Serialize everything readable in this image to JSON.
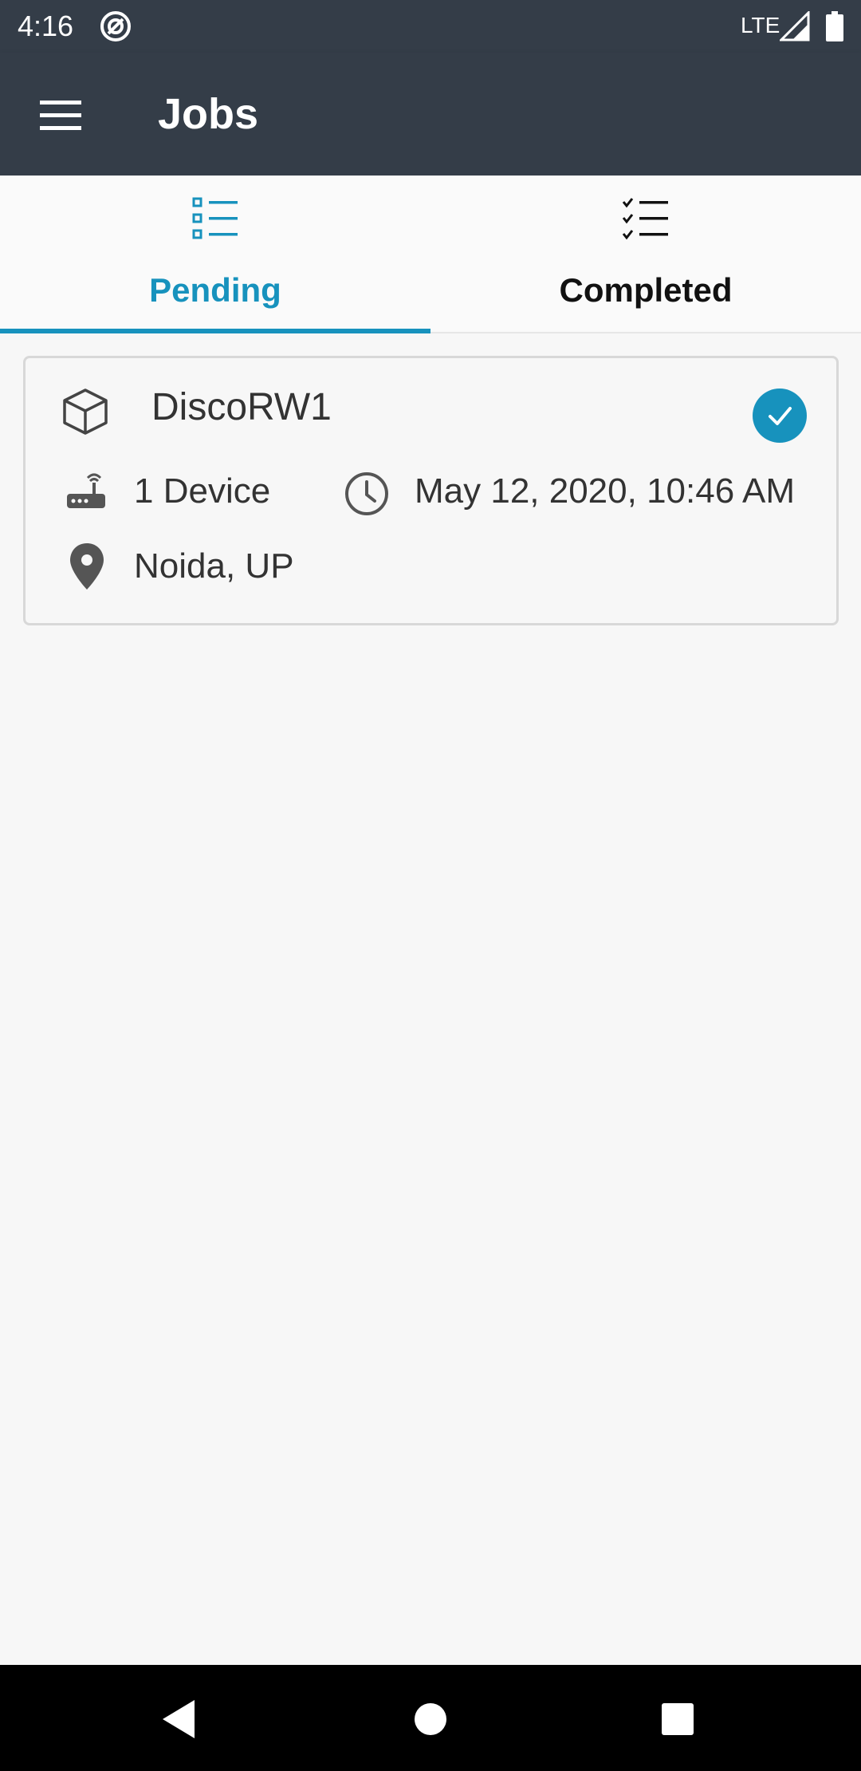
{
  "status_bar": {
    "time": "4:16",
    "network": "LTE"
  },
  "app_bar": {
    "title": "Jobs"
  },
  "tabs": [
    {
      "label": "Pending",
      "selected": true,
      "icon": "list-icon"
    },
    {
      "label": "Completed",
      "selected": false,
      "icon": "checklist-icon"
    }
  ],
  "jobs": [
    {
      "name": "DiscoRW1",
      "device_count": "1 Device",
      "timestamp": "May 12, 2020, 10:46 AM",
      "location": "Noida, UP",
      "status": "check-circle-icon"
    }
  ],
  "colors": {
    "accent": "#1792bd",
    "app_bar": "#343d48",
    "background": "#f7f7f7"
  }
}
